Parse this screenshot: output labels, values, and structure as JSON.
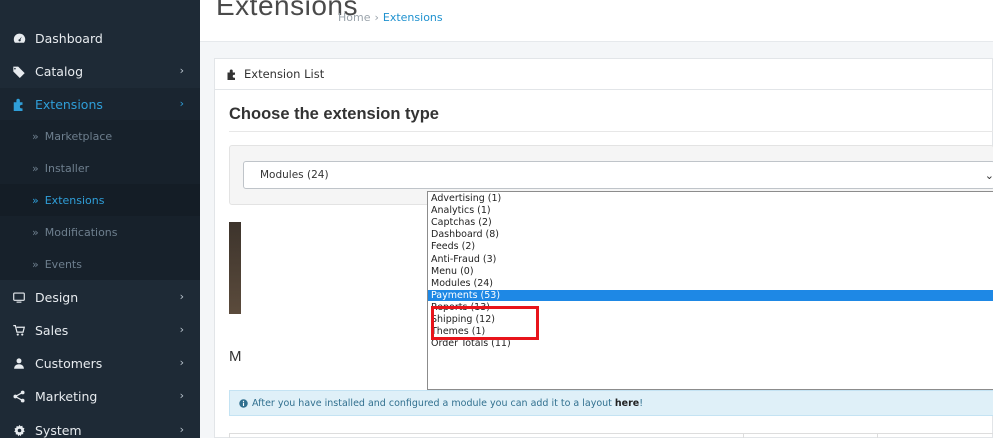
{
  "sidebar": {
    "items": [
      {
        "label": "Dashboard",
        "icon": "dashboard-icon"
      },
      {
        "label": "Catalog",
        "icon": "tag-icon"
      },
      {
        "label": "Extensions",
        "icon": "puzzle-icon"
      },
      {
        "label": "Design",
        "icon": "monitor-icon"
      },
      {
        "label": "Sales",
        "icon": "cart-icon"
      },
      {
        "label": "Customers",
        "icon": "user-icon"
      },
      {
        "label": "Marketing",
        "icon": "share-icon"
      },
      {
        "label": "System",
        "icon": "gear-icon"
      }
    ],
    "sub_items": [
      "Marketplace",
      "Installer",
      "Extensions",
      "Modifications",
      "Events"
    ],
    "sub_prefix": "»",
    "arrow": "›"
  },
  "header": {
    "title": "Extensions",
    "breadcrumb": [
      "Home",
      "Extensions"
    ],
    "breadcrumb_separator": "›"
  },
  "panel": {
    "heading": "Extension List",
    "section_title": "Choose the extension type",
    "select_value": "Modules (24)",
    "select_caret": "⌄"
  },
  "dropdown": {
    "options": [
      "Advertising (1)",
      "Analytics (1)",
      "Captchas (2)",
      "Dashboard (8)",
      "Feeds (2)",
      "Anti-Fraud (3)",
      "Menu (0)",
      "Modules (24)",
      "Payments (53)",
      "Reports (13)",
      "Shipping (12)",
      "Themes (1)",
      "Order Totals (11)"
    ],
    "selected_index": 8
  },
  "background": {
    "partial_heading": "M",
    "alert_text": "After you have installed and configured a module you can add it to a layout",
    "alert_link": "here",
    "alert_end": "!"
  },
  "colors": {
    "sidebar_bg": "#1e2a36",
    "accent": "#2f9ed8",
    "selected_option": "#1e88e5",
    "highlight": "#e8141b"
  }
}
